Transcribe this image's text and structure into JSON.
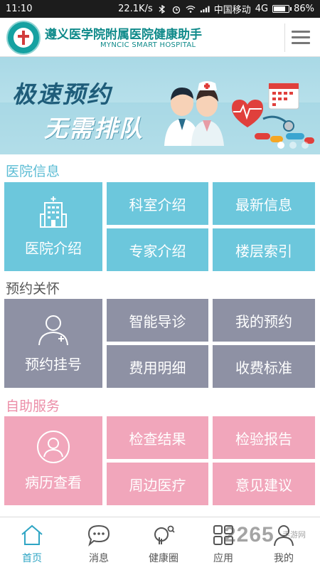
{
  "status_bar": {
    "time": "11:10",
    "net_speed": "22.1K/s",
    "carrier": "中国移动",
    "network": "4G",
    "battery": "86%",
    "battery_level": 0.86
  },
  "header": {
    "title": "遵义医学院附属医院健康助手",
    "subtitle": "MYNCIC SMART HOSPITAL"
  },
  "banner": {
    "line1": "极速预约",
    "line2": "无需排队",
    "slide_count": 3,
    "active_slide": 0
  },
  "sections": {
    "hospital_info": {
      "title": "医院信息",
      "main": "医院介绍",
      "items": [
        "科室介绍",
        "最新信息",
        "专家介绍",
        "楼层索引"
      ]
    },
    "appointment": {
      "title": "预约关怀",
      "main": "预约挂号",
      "items": [
        "智能导诊",
        "我的预约",
        "费用明细",
        "收费标准"
      ]
    },
    "self_service": {
      "title": "自助服务",
      "main": "病历查看",
      "items": [
        "检查结果",
        "检验报告",
        "周边医疗",
        "意见建议"
      ]
    }
  },
  "tabbar": {
    "tabs": [
      "首页",
      "消息",
      "健康圈",
      "应用",
      "我的"
    ],
    "active": 0
  },
  "watermark": {
    "text": "2265",
    "small": "手游网"
  },
  "colors": {
    "teal": "#0f8a8a",
    "blue_tile": "#6cc7dc",
    "gray_tile": "#8e91a4",
    "pink_tile": "#f1a6bb",
    "active_tab": "#2fa5c4"
  }
}
